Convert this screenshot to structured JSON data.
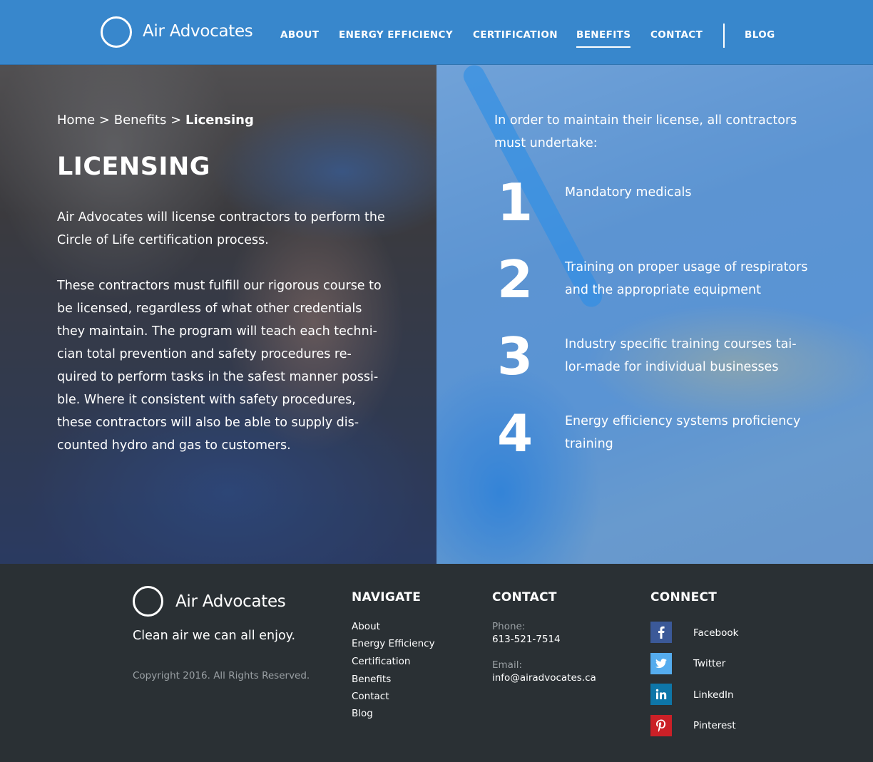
{
  "brand": {
    "name": "Air Advocates"
  },
  "nav": {
    "items": [
      {
        "label": "ABOUT"
      },
      {
        "label": "ENERGY EFFICIENCY"
      },
      {
        "label": "CERTIFICATION"
      },
      {
        "label": "BENEFITS"
      },
      {
        "label": "CONTACT"
      },
      {
        "label": "BLOG"
      }
    ],
    "active": "BENEFITS"
  },
  "breadcrumb": {
    "home": "Home",
    "separator": ">",
    "section": "Benefits",
    "current": "Licensing"
  },
  "page": {
    "title": "LICENSING",
    "paragraphs": [
      "Air Advocates will license contractors to perform the Circle of Life certification process.",
      "These contractors must fulfill our rigorous course to be licensed, regardless of what other credentials they maintain. The program will teach each techni-cian total prevention and safety procedures re-quired to perform tasks in the safest manner possi-ble. Where it consistent with safety procedures, these contractors will also be able to supply dis-counted hydro and gas to customers."
    ],
    "requirements_intro": "In order to maintain their license, all contractors must undertake:",
    "requirements": [
      {
        "number": "1",
        "text": "Mandatory medicals"
      },
      {
        "number": "2",
        "text": "Training on proper usage of respirators and the appropriate equipment"
      },
      {
        "number": "3",
        "text": "Industry specific training courses tai-lor-made for individual businesses"
      },
      {
        "number": "4",
        "text": "Energy efficiency systems proficiency training"
      }
    ]
  },
  "footer": {
    "brand_name": "Air Advocates",
    "tagline": "Clean air we can all enjoy.",
    "copyright": "Copyright 2016. All Rights Reserved.",
    "navigate": {
      "heading": "NAVIGATE",
      "links": [
        "About",
        "Energy Efficiency",
        "Certification",
        "Benefits",
        "Contact",
        "Blog"
      ]
    },
    "contact": {
      "heading": "CONTACT",
      "phone_label": "Phone:",
      "phone": "613-521-7514",
      "email_label": "Email:",
      "email": "info@airadvocates.ca"
    },
    "connect": {
      "heading": "CONNECT",
      "links": [
        {
          "label": "Facebook",
          "icon": "facebook-icon",
          "color": "#3b5998",
          "glyph": "f"
        },
        {
          "label": "Twitter",
          "icon": "twitter-icon",
          "color": "#55acee",
          "glyph": "t"
        },
        {
          "label": "LinkedIn",
          "icon": "linkedin-icon",
          "color": "#0e76a8",
          "glyph": "in"
        },
        {
          "label": "Pinterest",
          "icon": "pinterest-icon",
          "color": "#cb2027",
          "glyph": "P"
        }
      ]
    }
  },
  "colors": {
    "header_bg": "#3887cc",
    "footer_bg": "#2a3034",
    "text": "#ffffff",
    "muted": "#9aa0a4"
  }
}
